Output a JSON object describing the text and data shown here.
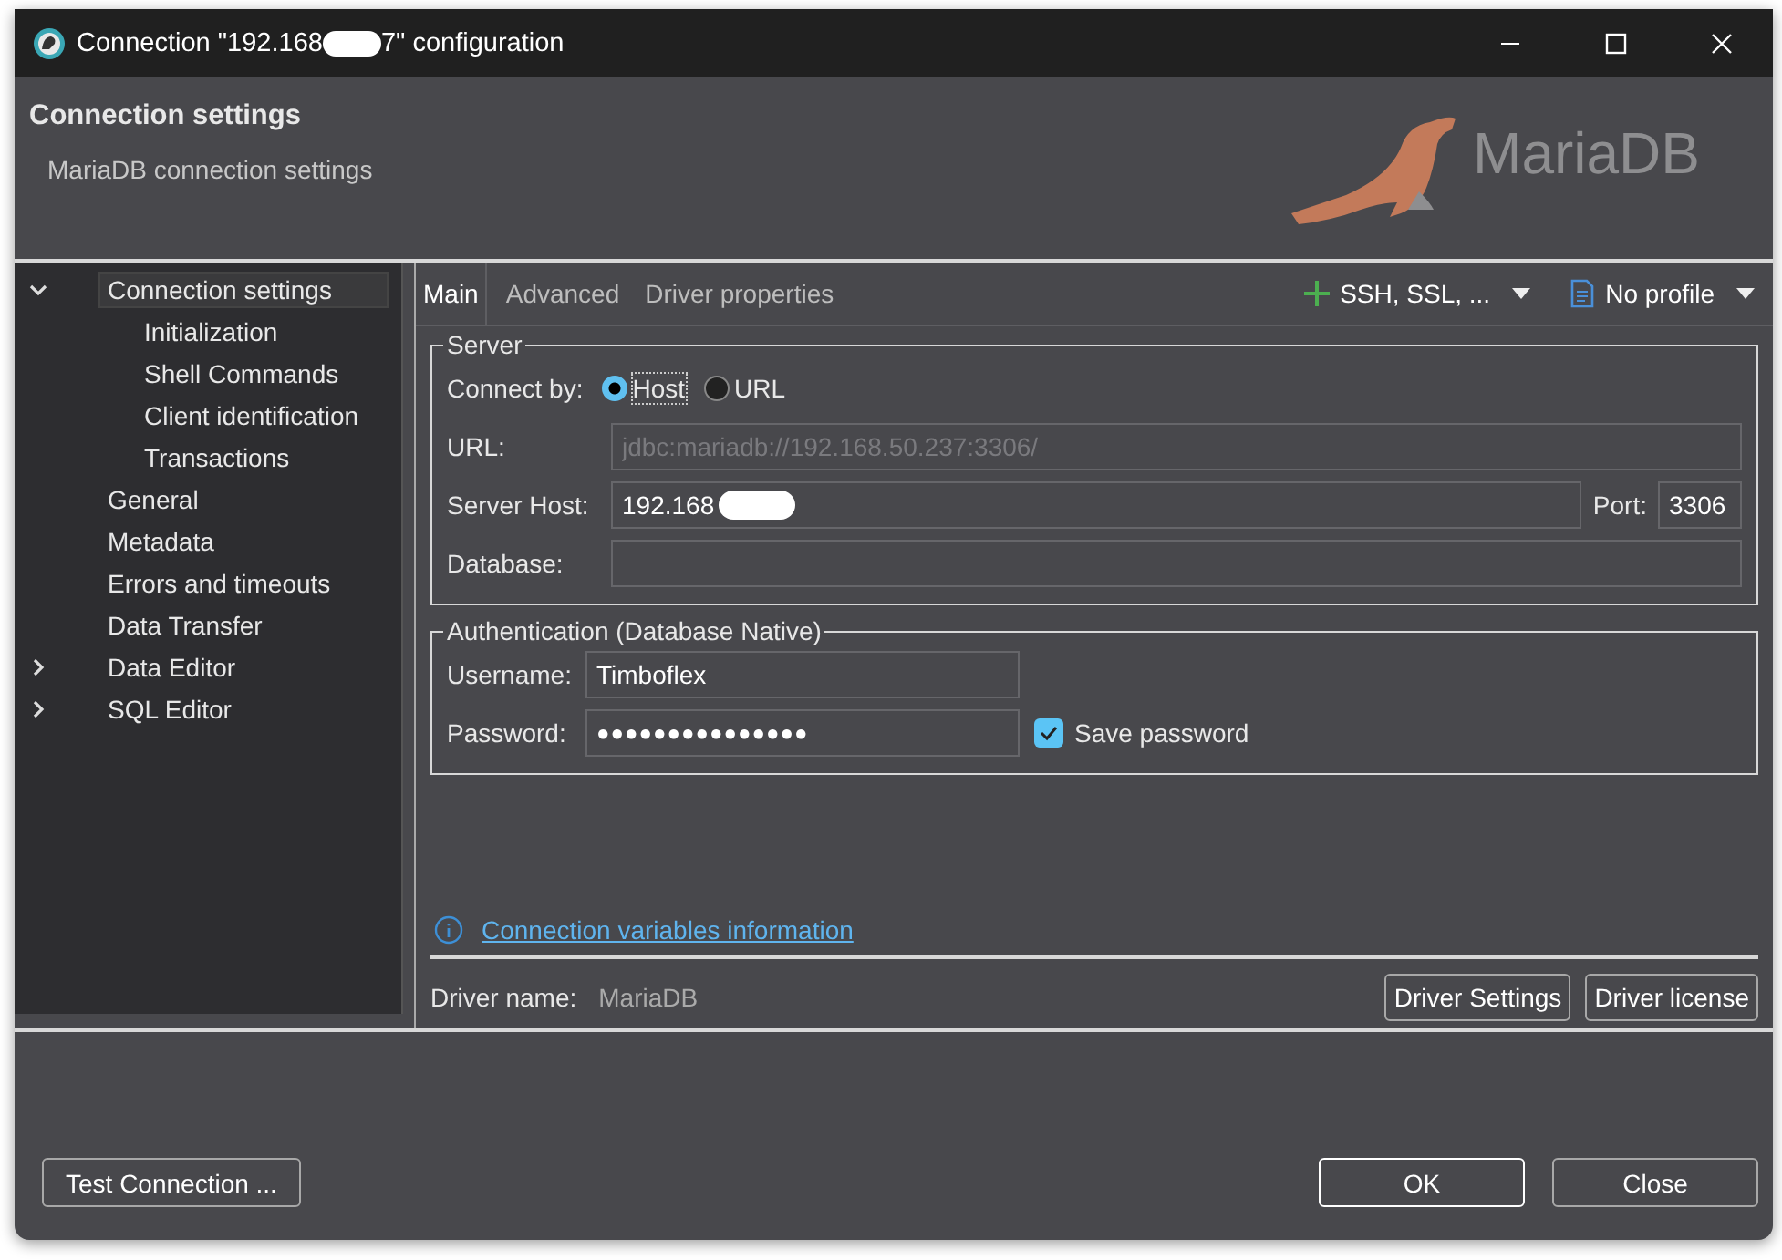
{
  "window": {
    "title_start": "Connection \"192.168",
    "title_end": "7\" configuration"
  },
  "header": {
    "title": "Connection settings",
    "subtitle": "MariaDB connection settings",
    "logo_text": "MariaDB"
  },
  "sidebar": {
    "items": [
      {
        "label": "Connection settings",
        "expanded": true,
        "selected": true,
        "children": [
          {
            "label": "Initialization",
            "selected": false
          },
          {
            "label": "Shell Commands",
            "selected": false
          },
          {
            "label": "Client identification",
            "selected": false
          },
          {
            "label": "Transactions",
            "selected": false
          }
        ]
      },
      {
        "label": "General",
        "selected": false
      },
      {
        "label": "Metadata",
        "selected": false
      },
      {
        "label": "Errors and timeouts",
        "selected": false
      },
      {
        "label": "Data Transfer",
        "selected": false
      },
      {
        "label": "Data Editor",
        "expanded": false,
        "selected": false
      },
      {
        "label": "SQL Editor",
        "expanded": false,
        "selected": false
      }
    ]
  },
  "tabs": [
    {
      "label": "Main",
      "selected": true
    },
    {
      "label": "Advanced",
      "selected": false
    },
    {
      "label": "Driver properties",
      "selected": false
    }
  ],
  "toolbar": {
    "network_button": "SSH, SSL, ...",
    "profile_button": "No profile"
  },
  "server": {
    "legend": "Server",
    "connect_by_label": "Connect by:",
    "options": [
      {
        "label": "Host",
        "selected": true
      },
      {
        "label": "URL",
        "selected": false
      }
    ],
    "url_label": "URL:",
    "url_value": "jdbc:mariadb://192.168.50.237:3306/",
    "url_disabled": true,
    "host_label": "Server Host:",
    "host_value": "192.168",
    "port_label": "Port:",
    "port_value": "3306",
    "database_label": "Database:"
  },
  "auth": {
    "legend": "Authentication (Database Native)",
    "username_label": "Username:",
    "username_value": "Timboflex",
    "password_label": "Password:",
    "password_value": "●●●●●●●●●●●●●●●",
    "save_password": {
      "label": "Save password",
      "checked": true
    }
  },
  "info_link": "Connection variables information",
  "driver": {
    "label": "Driver name:",
    "value": "MariaDB",
    "buttons": [
      "Driver Settings",
      "Driver license"
    ]
  },
  "footer": {
    "test_button": "Test Connection ...",
    "buttons": [
      "OK",
      "Close"
    ]
  }
}
